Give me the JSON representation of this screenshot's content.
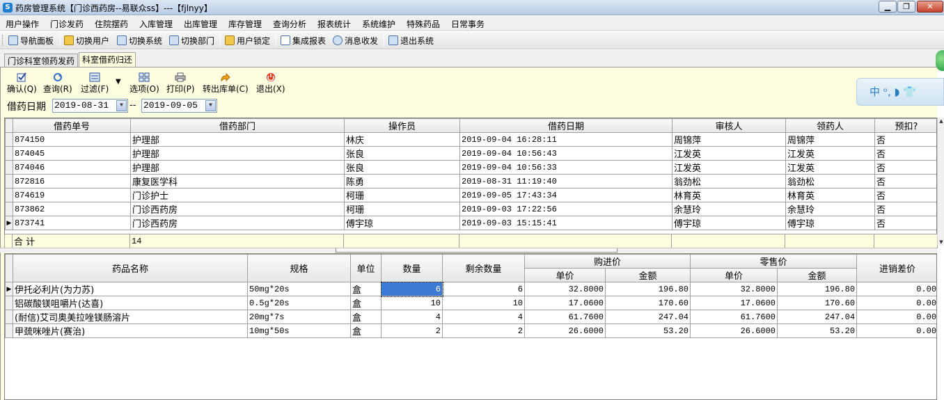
{
  "window": {
    "title": "药房管理系统【门诊西药房--易联众ss】---【fjlnyy】",
    "min": "▁",
    "max": "❐",
    "close": "✕"
  },
  "menu": [
    "用户操作",
    "门诊发药",
    "住院摆药",
    "入库管理",
    "出库管理",
    "库存管理",
    "查询分析",
    "报表统计",
    "系统维护",
    "特殊药品",
    "日常事务"
  ],
  "toolbar": [
    {
      "label": "导航面板",
      "icon": "dashboard-icon"
    },
    {
      "label": "切换用户",
      "icon": "users-icon"
    },
    {
      "label": "切换系统",
      "icon": "switch-system-icon"
    },
    {
      "label": "切换部门",
      "icon": "department-icon"
    },
    {
      "label": "用户锁定",
      "icon": "lock-user-icon"
    },
    {
      "label": "集成报表",
      "icon": "report-icon"
    },
    {
      "label": "消息收发",
      "icon": "info-icon"
    },
    {
      "label": "退出系统",
      "icon": "exit-icon"
    }
  ],
  "tabs": [
    "门诊科室领药发药",
    "科室借药归还"
  ],
  "actions": [
    {
      "label": "确认(Q)",
      "icon": "checkbox-icon"
    },
    {
      "label": "查询(R)",
      "icon": "refresh-icon"
    },
    {
      "label": "过滤(F)",
      "icon": "filter-icon"
    },
    {
      "label": "选项(O)",
      "icon": "options-icon"
    },
    {
      "label": "打印(P)",
      "icon": "printer-icon"
    },
    {
      "label": "转出库单(C)",
      "icon": "arrow-icon"
    },
    {
      "label": "退出(X)",
      "icon": "power-icon"
    }
  ],
  "badge": "中 ᵒ, ◗ 👕",
  "filter": {
    "label": "借药日期",
    "from": "2019-08-31",
    "sep": "--",
    "to": "2019-09-05"
  },
  "grid1": {
    "headers": [
      "借药单号",
      "借药部门",
      "操作员",
      "借药日期",
      "审核人",
      "领药人",
      "预扣?"
    ],
    "rows": [
      [
        "874150",
        "护理部",
        "林庆",
        "2019-09-04 16:28:11",
        "周锦萍",
        "周锦萍",
        "否"
      ],
      [
        "874045",
        "护理部",
        "张良",
        "2019-09-04 10:56:43",
        "江发英",
        "江发英",
        "否"
      ],
      [
        "874046",
        "护理部",
        "张良",
        "2019-09-04 10:56:33",
        "江发英",
        "江发英",
        "否"
      ],
      [
        "872816",
        "康复医学科",
        "陈勇",
        "2019-08-31 11:19:40",
        "翁劲松",
        "翁劲松",
        "否"
      ],
      [
        "874619",
        "门诊护士",
        "柯珊",
        "2019-09-05 17:43:34",
        "林育英",
        "林育英",
        "否"
      ],
      [
        "873862",
        "门诊西药房",
        "柯珊",
        "2019-09-03 17:22:56",
        "余慧玲",
        "余慧玲",
        "否"
      ],
      [
        "873741",
        "门诊西药房",
        "傅宇琼",
        "2019-09-03 15:15:41",
        "傅宇琼",
        "傅宇琼",
        "否"
      ]
    ],
    "current_row": 6,
    "summary": {
      "label": "合  计",
      "count": "14"
    }
  },
  "grid2": {
    "headers": {
      "name": "药品名称",
      "spec": "规格",
      "unit": "单位",
      "qty": "数量",
      "remain": "剩余数量",
      "purchase": "购进价",
      "retail": "零售价",
      "unit_price": "单价",
      "amount": "金额",
      "diff": "进销差价"
    },
    "rows": [
      [
        "伊托必利片(为力苏)",
        "50mg*20s",
        "盒",
        "6",
        "6",
        "32.8000",
        "196.80",
        "32.8000",
        "196.80",
        "0.00"
      ],
      [
        "铝碳酸镁咀嚼片(达喜)",
        "0.5g*20s",
        "盒",
        "10",
        "10",
        "17.0600",
        "170.60",
        "17.0600",
        "170.60",
        "0.00"
      ],
      [
        "(耐信)艾司奥美拉唑镁肠溶片",
        "20mg*7s",
        "盒",
        "4",
        "4",
        "61.7600",
        "247.04",
        "61.7600",
        "247.04",
        "0.00"
      ],
      [
        "甲巯咪唑片(赛治)",
        "10mg*50s",
        "盒",
        "2",
        "2",
        "26.6000",
        "53.20",
        "26.6000",
        "53.20",
        "0.00"
      ]
    ],
    "current_row": 0
  }
}
